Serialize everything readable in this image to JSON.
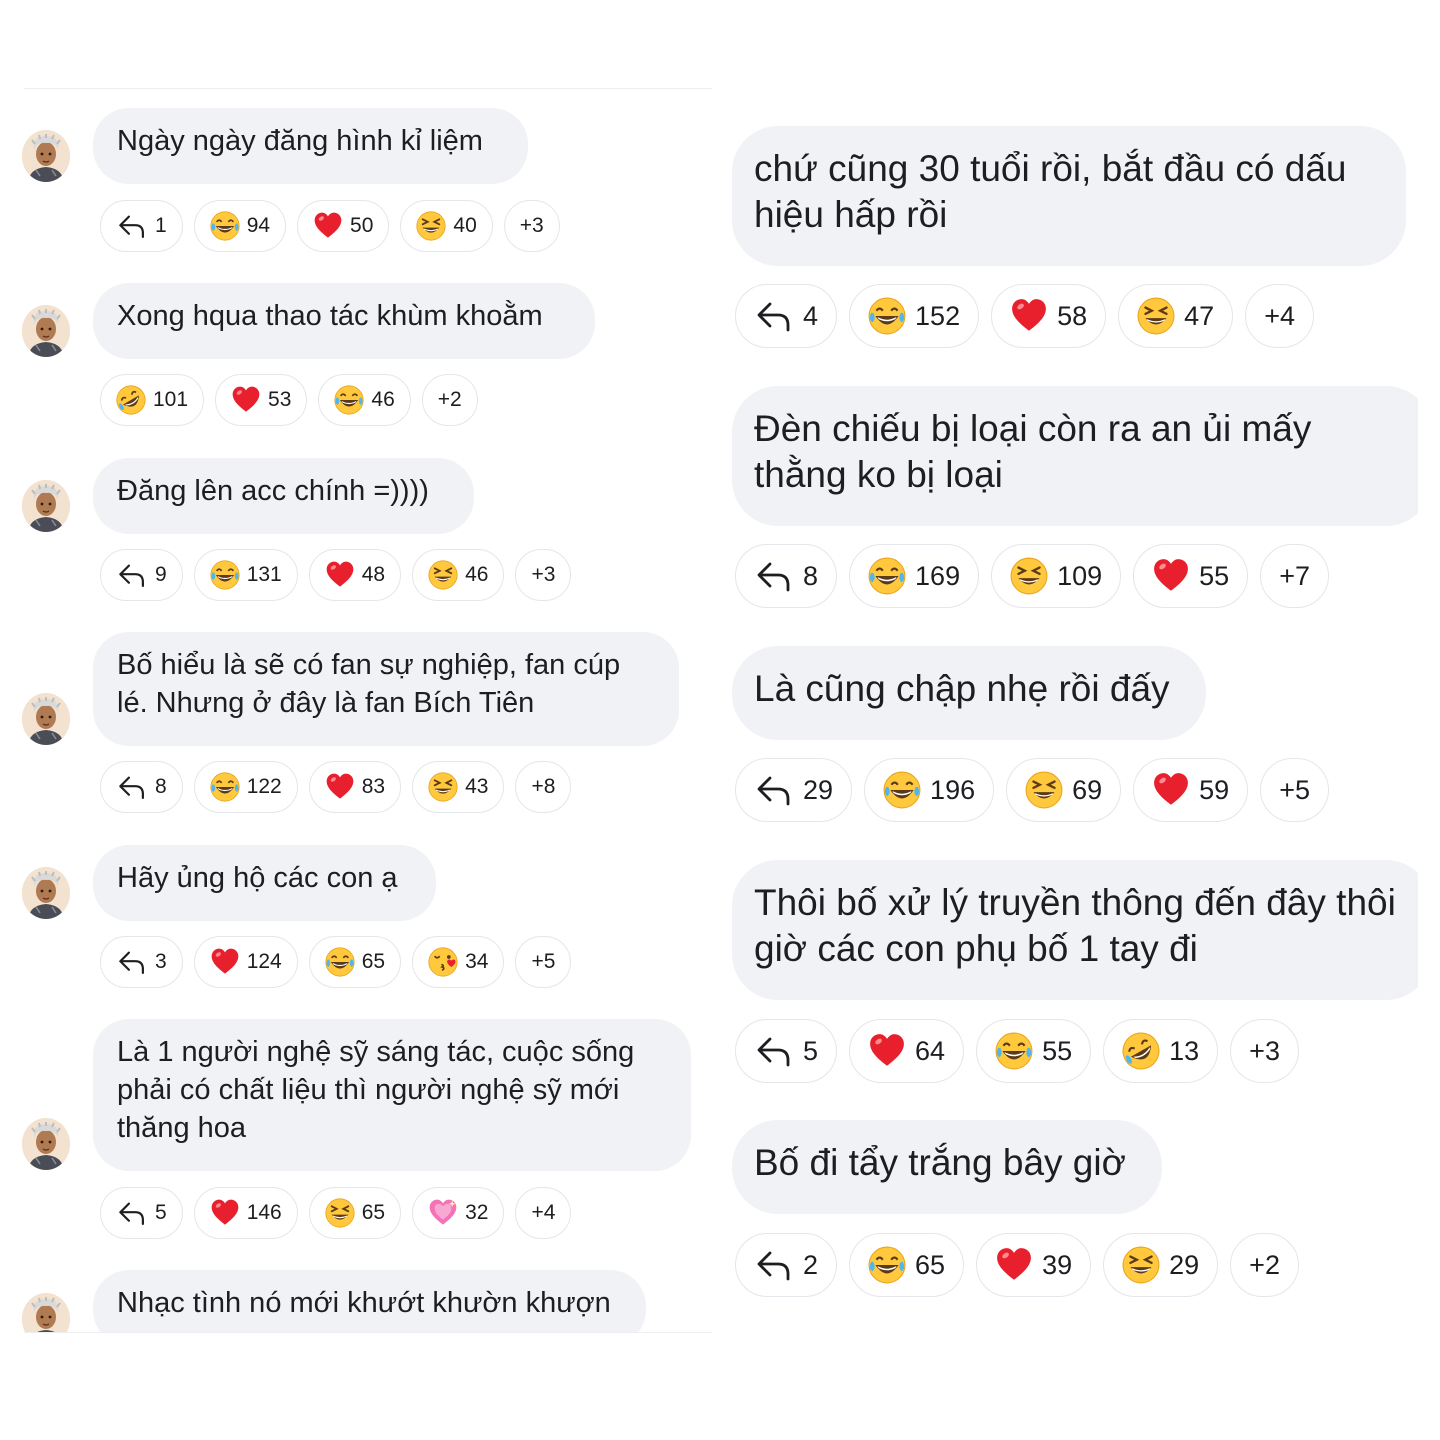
{
  "left_comments": [
    {
      "text": "Ngày ngày đăng hình kỉ liệm",
      "replies": "1",
      "reactions": [
        {
          "icon": "laughing-tears-icon",
          "count": "94"
        },
        {
          "icon": "heart-icon",
          "count": "50"
        },
        {
          "icon": "grinning-squint-icon",
          "count": "40"
        }
      ],
      "more": "+3"
    },
    {
      "text": "Xong hqua thao tác khùm khoằm",
      "replies": null,
      "reactions": [
        {
          "icon": "rofl-icon",
          "count": "101"
        },
        {
          "icon": "heart-icon",
          "count": "53"
        },
        {
          "icon": "laughing-tears-icon",
          "count": "46"
        }
      ],
      "more": "+2"
    },
    {
      "text": "Đăng lên acc chính =))))",
      "replies": "9",
      "reactions": [
        {
          "icon": "laughing-tears-icon",
          "count": "131"
        },
        {
          "icon": "heart-icon",
          "count": "48"
        },
        {
          "icon": "grinning-squint-icon",
          "count": "46"
        }
      ],
      "more": "+3"
    },
    {
      "text": "Bố hiểu là sẽ có fan sự nghiệp, fan cúp lé. Nhưng ở đây là fan Bích Tiên",
      "replies": "8",
      "reactions": [
        {
          "icon": "laughing-tears-icon",
          "count": "122"
        },
        {
          "icon": "heart-icon",
          "count": "83"
        },
        {
          "icon": "grinning-squint-icon",
          "count": "43"
        }
      ],
      "more": "+8"
    },
    {
      "text": "Hãy ủng hộ các con ạ",
      "replies": "3",
      "reactions": [
        {
          "icon": "heart-icon",
          "count": "124"
        },
        {
          "icon": "laughing-tears-icon",
          "count": "65"
        },
        {
          "icon": "kissing-heart-icon",
          "count": "34"
        }
      ],
      "more": "+5"
    },
    {
      "text": "Là 1 người nghệ sỹ sáng tác, cuộc sống phải có chất liệu thì người nghệ sỹ mới thăng hoa",
      "replies": "5",
      "reactions": [
        {
          "icon": "heart-icon",
          "count": "146"
        },
        {
          "icon": "grinning-squint-icon",
          "count": "65"
        },
        {
          "icon": "sparkling-heart-icon",
          "count": "32"
        }
      ],
      "more": "+4"
    },
    {
      "text": "Nhạc tình nó mới khướt khườn khượn",
      "replies": null,
      "reactions": [],
      "more": null
    }
  ],
  "right_comments": [
    {
      "text": "chứ cũng 30 tuổi rồi, bắt đầu có dấu hiệu hấp rồi",
      "replies": "4",
      "reactions": [
        {
          "icon": "laughing-tears-icon",
          "count": "152"
        },
        {
          "icon": "heart-icon",
          "count": "58"
        },
        {
          "icon": "grinning-squint-icon",
          "count": "47"
        }
      ],
      "more": "+4"
    },
    {
      "text": "Đèn chiếu bị loại còn ra an ủi mấy thằng ko bị loại",
      "replies": "8",
      "reactions": [
        {
          "icon": "laughing-tears-icon",
          "count": "169"
        },
        {
          "icon": "grinning-squint-icon",
          "count": "109"
        },
        {
          "icon": "heart-icon",
          "count": "55"
        }
      ],
      "more": "+7"
    },
    {
      "text": "Là cũng chập nhẹ rồi đấy",
      "replies": "29",
      "reactions": [
        {
          "icon": "laughing-tears-icon",
          "count": "196"
        },
        {
          "icon": "grinning-squint-icon",
          "count": "69"
        },
        {
          "icon": "heart-icon",
          "count": "59"
        }
      ],
      "more": "+5"
    },
    {
      "text": "Thôi bố xử lý truyền thông đến đây thôi giờ các con phụ bố 1 tay đi",
      "replies": "5",
      "reactions": [
        {
          "icon": "heart-icon",
          "count": "64"
        },
        {
          "icon": "laughing-tears-icon",
          "count": "55"
        },
        {
          "icon": "rofl-icon",
          "count": "13"
        }
      ],
      "more": "+3"
    },
    {
      "text": "Bố đi tẩy trắng bây giờ",
      "replies": "2",
      "reactions": [
        {
          "icon": "laughing-tears-icon",
          "count": "65"
        },
        {
          "icon": "heart-icon",
          "count": "39"
        },
        {
          "icon": "grinning-squint-icon",
          "count": "29"
        }
      ],
      "more": "+2"
    }
  ],
  "colors": {
    "bubble": "#f0f2f5",
    "pill_border": "#e4e6eb",
    "text": "#1c1e21",
    "heart": "#e8202e",
    "emoji_yellow": "#ffc83d"
  }
}
